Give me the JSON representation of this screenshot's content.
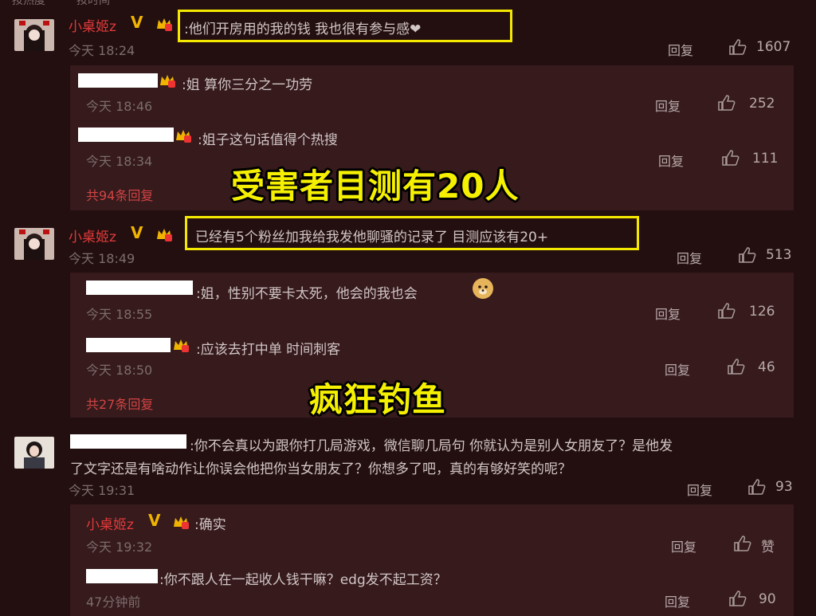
{
  "topbar": {
    "left": "按热度",
    "right": "按时间"
  },
  "comments": [
    {
      "user": "小桌姬z",
      "text": ":他们开房用的我的钱 我也很有参与感❤",
      "time": "今天 18:24",
      "reply": "回复",
      "likes": "1607",
      "replies": [
        {
          "text": ":姐 算你三分之一功劳",
          "time": "今天 18:46",
          "reply": "回复",
          "likes": "252"
        },
        {
          "text": ":姐子这句话值得个热搜",
          "time": "今天 18:34",
          "reply": "回复",
          "likes": "111"
        }
      ],
      "more": "共94条回复"
    },
    {
      "user": "小桌姬z",
      "text": "已经有5个粉丝加我给我发他聊骚的记录了 目测应该有20+",
      "time": "今天 18:49",
      "reply": "回复",
      "likes": "513",
      "replies": [
        {
          "text": ":姐，性别不要卡太死，他会的我也会",
          "time": "今天 18:55",
          "reply": "回复",
          "likes": "126"
        },
        {
          "text": ":应该去打中单 时间刺客",
          "time": "今天 18:50",
          "reply": "回复",
          "likes": "46"
        }
      ],
      "more": "共27条回复"
    },
    {
      "text_line1": ":你不会真以为跟你打几局游戏，微信聊几局句 你就认为是别人女朋友了？是他发",
      "text_line2": "了文字还是有啥动作让你误会他把你当女朋友了？你想多了吧，真的有够好笑的呢？",
      "time": "今天 19:31",
      "reply": "回复",
      "likes": "93",
      "replies": [
        {
          "user": "小桌姬z",
          "text": ":确实",
          "time": "今天 19:32",
          "reply": "回复",
          "likes": "赞"
        },
        {
          "text": ":你不跟人在一起收人钱干嘛？edg发不起工资？",
          "time": "47分钟前",
          "reply": "回复",
          "likes": "90"
        }
      ]
    }
  ],
  "overlays": {
    "caption1": "受害者目测有20人",
    "caption2": "疯狂钓鱼"
  },
  "colors": {
    "background": "#230f10",
    "sub_background": "#361a1c",
    "username": "#e23a3a",
    "highlight": "#f5e800",
    "badge": "#f0b400"
  }
}
